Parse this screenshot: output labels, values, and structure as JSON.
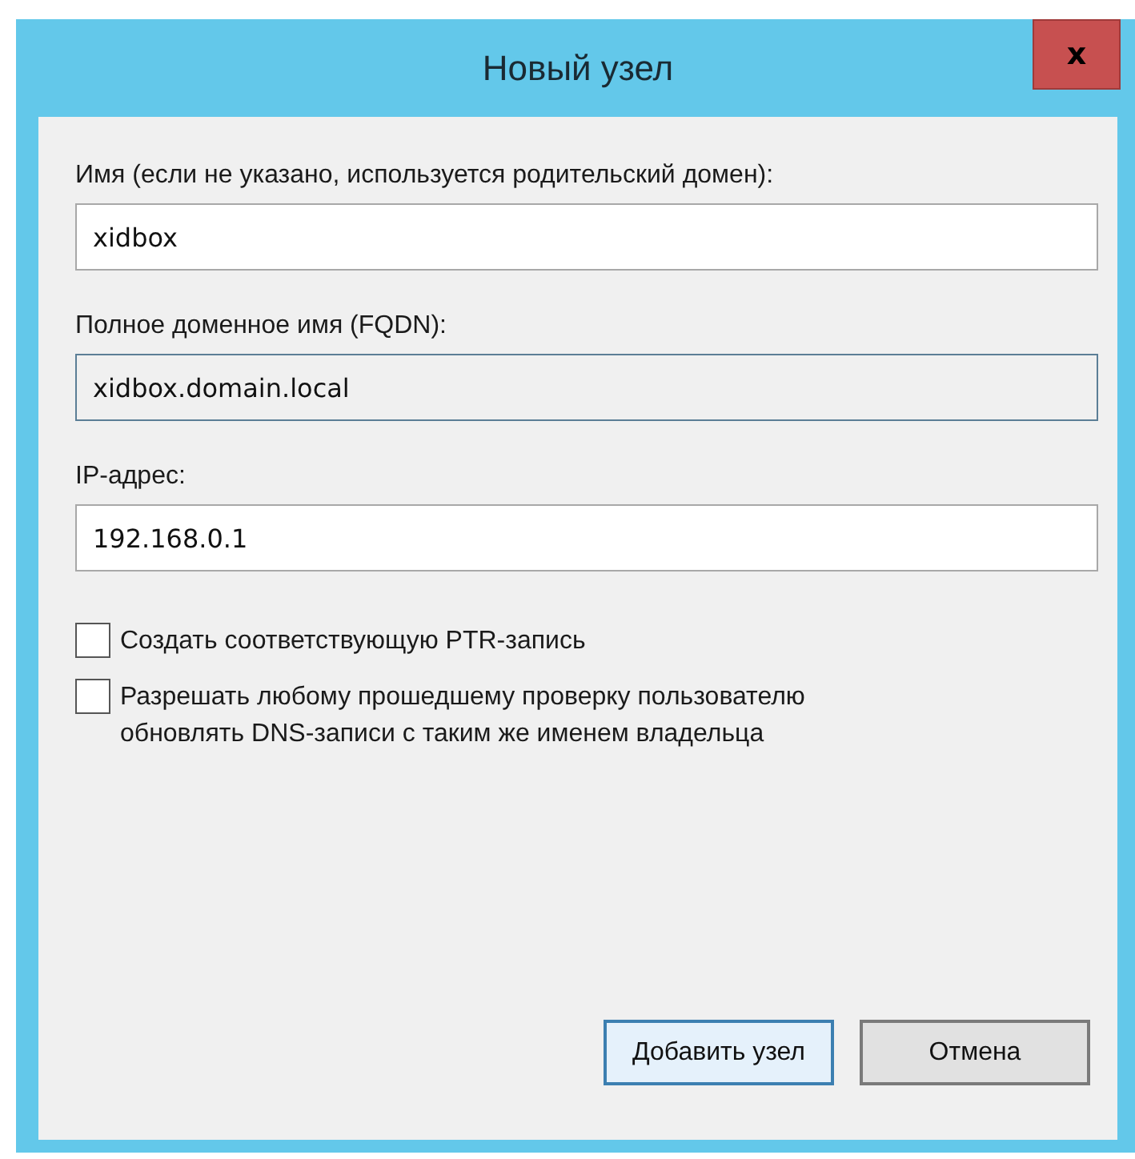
{
  "window": {
    "title": "Новый узел",
    "close": "x"
  },
  "fields": [
    {
      "label": "Имя (если не указано, используется родительский домен):",
      "value": "xidbox",
      "readonly": false
    },
    {
      "label": "Полное доменное имя (FQDN):",
      "value": "xidbox.domain.local",
      "readonly": true
    },
    {
      "label": "IP-адрес:",
      "value": "192.168.0.1",
      "readonly": false
    }
  ],
  "checkboxes": [
    {
      "label": "Создать соответствующую PTR-запись",
      "checked": false
    },
    {
      "label": "Разрешать любому прошедшему проверку пользователю обновлять DNS-записи с таким же именем владельца",
      "checked": false
    }
  ],
  "buttons": [
    {
      "label": "Добавить узел",
      "default": true
    },
    {
      "label": "Отмена",
      "default": false
    }
  ]
}
